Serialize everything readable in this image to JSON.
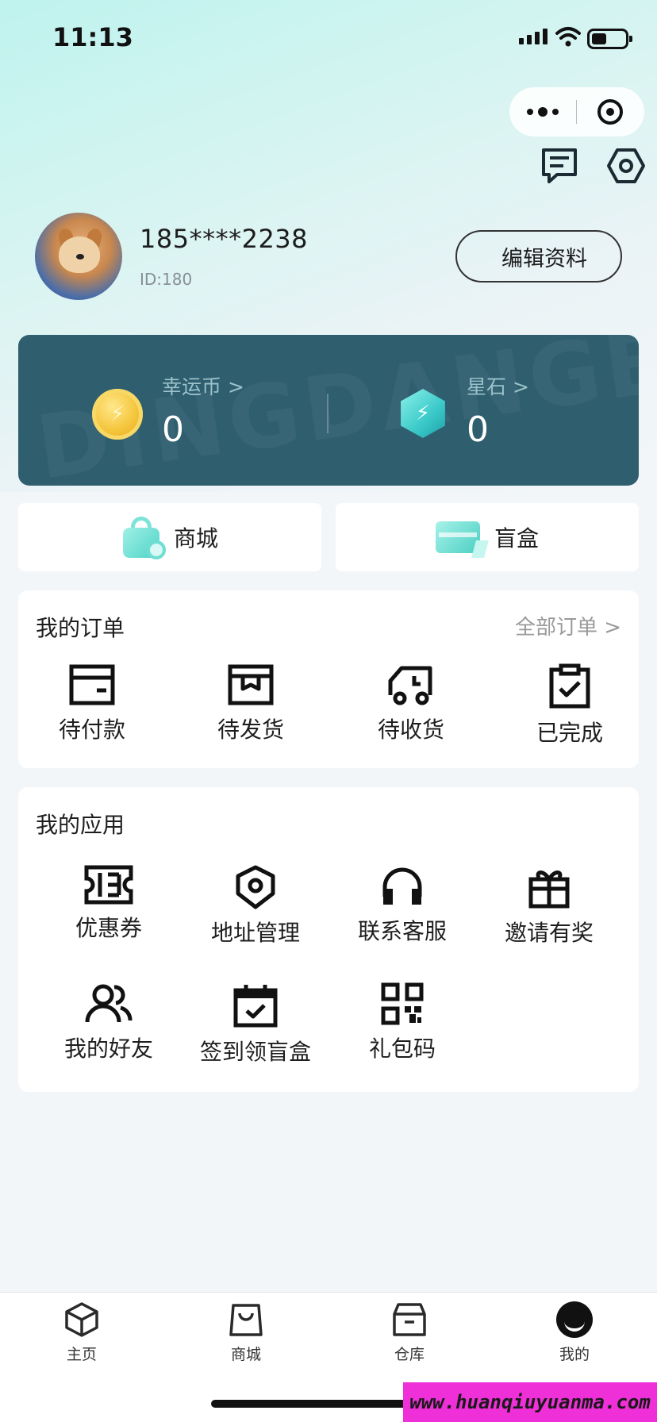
{
  "status_bar": {
    "time": "11:13"
  },
  "profile": {
    "phone": "185****2238",
    "id_text": "ID:180",
    "edit_label": "编辑资料"
  },
  "wallet": {
    "coin_label": "幸运币 >",
    "coin_value": "0",
    "gem_label": "星石 >",
    "gem_value": "0"
  },
  "shortcuts": {
    "shop": "商城",
    "blind_box": "盲盒"
  },
  "orders": {
    "title": "我的订单",
    "all_label": "全部订单 >",
    "items": [
      {
        "label": "待付款",
        "icon": "wallet-icon"
      },
      {
        "label": "待发货",
        "icon": "package-icon"
      },
      {
        "label": "待收货",
        "icon": "truck-icon"
      },
      {
        "label": "已完成",
        "icon": "clipboard-check-icon"
      }
    ]
  },
  "apps": {
    "title": "我的应用",
    "items": [
      {
        "label": "优惠券",
        "icon": "coupon-icon"
      },
      {
        "label": "地址管理",
        "icon": "location-icon"
      },
      {
        "label": "联系客服",
        "icon": "headphones-icon"
      },
      {
        "label": "邀请有奖",
        "icon": "gift-icon"
      },
      {
        "label": "我的好友",
        "icon": "friends-icon"
      },
      {
        "label": "签到领盲盒",
        "icon": "calendar-check-icon"
      },
      {
        "label": "礼包码",
        "icon": "qrcode-icon"
      }
    ]
  },
  "tabbar": {
    "items": [
      {
        "label": "主页",
        "icon": "cube-icon"
      },
      {
        "label": "商城",
        "icon": "shopping-bag-icon"
      },
      {
        "label": "仓库",
        "icon": "warehouse-box-icon"
      },
      {
        "label": "我的",
        "icon": "profile-face-icon"
      }
    ]
  },
  "watermark": "www.huanqiuyuanma.com",
  "colors": {
    "wallet_bg": "#2f5f6f",
    "accent_teal": "#4fd3c7",
    "background": "#f3f6f9"
  }
}
